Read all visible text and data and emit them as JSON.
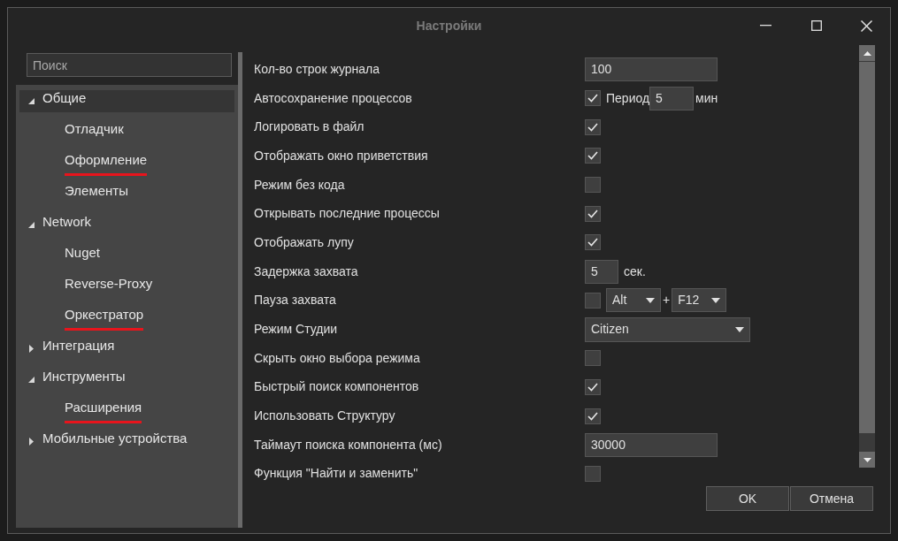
{
  "window": {
    "title": "Настройки"
  },
  "sidebar": {
    "search": {
      "placeholder": "Поиск"
    },
    "items": [
      {
        "label": "Общие",
        "expanded": true,
        "selected": true,
        "underlined": false,
        "children": [
          {
            "label": "Отладчик",
            "selected": false,
            "underlined": false
          },
          {
            "label": "Оформление",
            "selected": false,
            "underlined": true
          },
          {
            "label": "Элементы",
            "selected": false,
            "underlined": false
          }
        ]
      },
      {
        "label": "Network",
        "expanded": true,
        "selected": false,
        "underlined": false,
        "children": [
          {
            "label": "Nuget",
            "selected": false,
            "underlined": false
          },
          {
            "label": "Reverse-Proxy",
            "selected": false,
            "underlined": false
          },
          {
            "label": "Оркестратор",
            "selected": false,
            "underlined": true
          }
        ]
      },
      {
        "label": "Интеграция",
        "expanded": false,
        "selected": false,
        "underlined": false
      },
      {
        "label": "Инструменты",
        "expanded": true,
        "selected": false,
        "underlined": false,
        "children": [
          {
            "label": "Расширения",
            "selected": false,
            "underlined": true
          }
        ]
      },
      {
        "label": "Мобильные устройства",
        "expanded": false,
        "selected": false,
        "underlined": false
      }
    ]
  },
  "settings": [
    {
      "label": "Кол-во строк журнала",
      "kind": "text",
      "value": "100"
    },
    {
      "label": "Автосохранение процессов",
      "kind": "period",
      "checked": true,
      "prefix": "Период",
      "value": "5",
      "unit": "мин"
    },
    {
      "label": "Логировать в файл",
      "kind": "checkbox",
      "checked": true
    },
    {
      "label": "Отображать окно приветствия",
      "kind": "checkbox",
      "checked": true
    },
    {
      "label": "Режим без кода",
      "kind": "checkbox",
      "checked": false
    },
    {
      "label": "Открывать последние процессы",
      "kind": "checkbox",
      "checked": true
    },
    {
      "label": "Отображать лупу",
      "kind": "checkbox",
      "checked": true
    },
    {
      "label": "Задержка захвата",
      "kind": "number",
      "value": "5",
      "unit": "сек."
    },
    {
      "label": "Пауза захвата",
      "kind": "hotkey",
      "checked": false,
      "modifier": "Alt",
      "joiner": "+",
      "key": "F12"
    },
    {
      "label": "Режим Студии",
      "kind": "select",
      "value": "Citizen"
    },
    {
      "label": "Скрыть окно выбора режима",
      "kind": "checkbox",
      "checked": false
    },
    {
      "label": "Быстрый поиск компонентов",
      "kind": "checkbox",
      "checked": true
    },
    {
      "label": "Использовать Структуру",
      "kind": "checkbox",
      "checked": true
    },
    {
      "label": "Таймаут поиска компонента (мс)",
      "kind": "text",
      "value": "30000"
    },
    {
      "label": "Функция \"Найти и заменить\"",
      "kind": "checkbox",
      "checked": false
    }
  ],
  "buttons": [
    "OK",
    "Отмена"
  ]
}
